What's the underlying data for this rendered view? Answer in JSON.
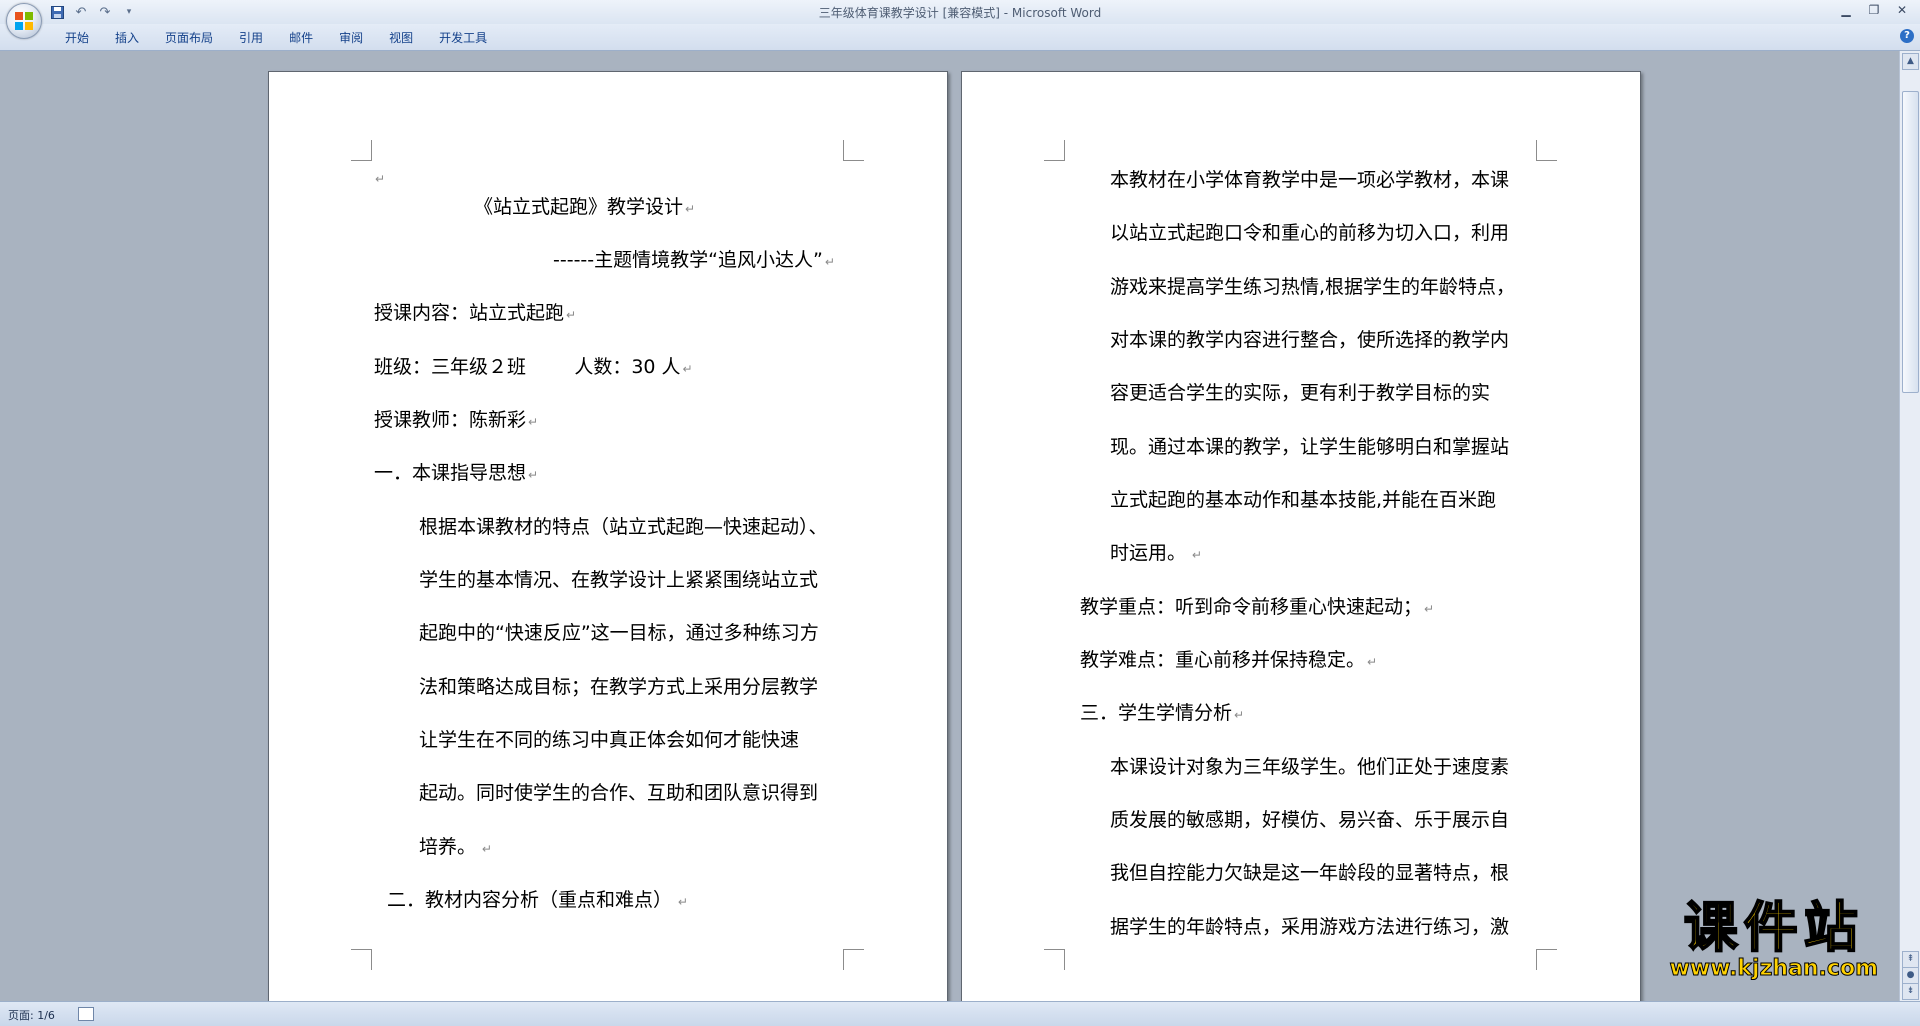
{
  "window": {
    "title": "三年级体育课教学设计 [兼容模式] - Microsoft Word"
  },
  "ribbon": {
    "tabs": [
      "开始",
      "插入",
      "页面布局",
      "引用",
      "邮件",
      "审阅",
      "视图",
      "开发工具"
    ]
  },
  "document": {
    "page1": {
      "lines": [
        "《站立式起跑》教学设计",
        "------主题情境教学“追风小达人”",
        "授课内容：站立式起跑",
        "班级：三年级２班        人数：30 人",
        "授课教师：陈新彩",
        "一．本课指导思想",
        "根据本课教材的特点（站立式起跑—快速起动）、",
        "学生的基本情况、在教学设计上紧紧围绕站立式",
        "起跑中的“快速反应”这一目标，通过多种练习方",
        "法和策略达成目标；在教学方式上采用分层教学",
        "让学生在不同的练习中真正体会如何才能快速",
        "起动。同时使学生的合作、互助和团队意识得到",
        "培养。",
        "二．教材内容分析（重点和难点）"
      ]
    },
    "page2": {
      "lines": [
        "本教材在小学体育教学中是一项必学教材，本课",
        "以站立式起跑口令和重心的前移为切入口，利用",
        "游戏来提高学生练习热情,根据学生的年龄特点，",
        "对本课的教学内容进行整合，使所选择的教学内",
        "容更适合学生的实际，更有利于教学目标的实",
        "现。通过本课的教学，让学生能够明白和掌握站",
        "立式起跑的基本动作和基本技能,并能在百米跑",
        "时运用。",
        "教学重点：听到命令前移重心快速起动；",
        "教学难点：重心前移并保持稳定。",
        "三．学生学情分析",
        "本课设计对象为三年级学生。他们正处于速度素",
        "质发展的敏感期，好模仿、易兴奋、乐于展示自",
        "我但自控能力欠缺是这一年龄段的显著特点，根",
        "据学生的年龄特点，采用游戏方法进行练习，激"
      ]
    }
  },
  "statusbar": {
    "page": "页面: 1/6"
  },
  "watermark": {
    "title": "课件站",
    "url": "www.kjzhan.com"
  },
  "icons": [
    "office-button-icon",
    "save-icon",
    "undo-icon",
    "redo-icon",
    "qat-dropdown-icon",
    "minimize-icon",
    "restore-icon",
    "close-icon",
    "help-icon",
    "paragraph-mark-icon"
  ]
}
